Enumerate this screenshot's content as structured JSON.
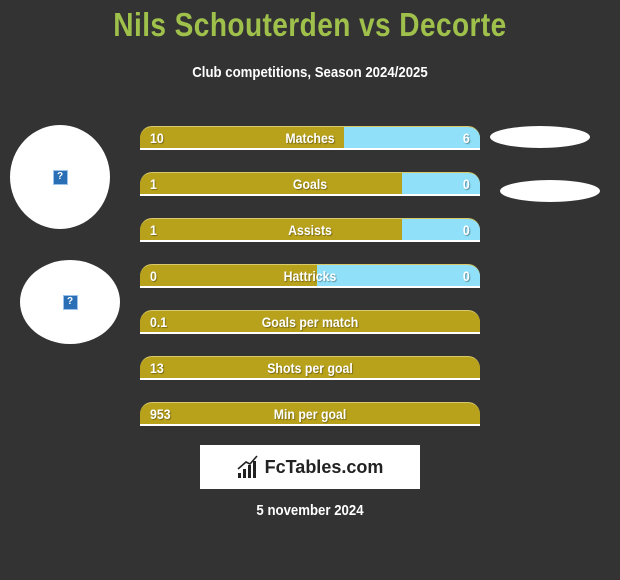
{
  "header": {
    "title": "Nils Schouterden vs Decorte",
    "subtitle": "Club competitions, Season 2024/2025"
  },
  "players": {
    "left_avatar_icon": "?",
    "left_avatar_2_icon": "?"
  },
  "colors": {
    "background": "#333333",
    "title": "#9fc04a",
    "left_bar": "#b9a21b",
    "right_bar": "#8fe0f8"
  },
  "stats": [
    {
      "label": "Matches",
      "left": "10",
      "right": "6",
      "left_share": 0.6
    },
    {
      "label": "Goals",
      "left": "1",
      "right": "0",
      "left_share": 0.77
    },
    {
      "label": "Assists",
      "left": "1",
      "right": "0",
      "left_share": 0.77
    },
    {
      "label": "Hattricks",
      "left": "0",
      "right": "0",
      "left_share": 0.52
    },
    {
      "label": "Goals per match",
      "left": "0.1",
      "right": "",
      "left_share": 1
    },
    {
      "label": "Shots per goal",
      "left": "13",
      "right": "",
      "left_share": 1
    },
    {
      "label": "Min per goal",
      "left": "953",
      "right": "",
      "left_share": 1
    }
  ],
  "logo": {
    "icon": "bar-chart-icon",
    "text": "FcTables.com"
  },
  "footer": {
    "date": "5 november 2024"
  }
}
